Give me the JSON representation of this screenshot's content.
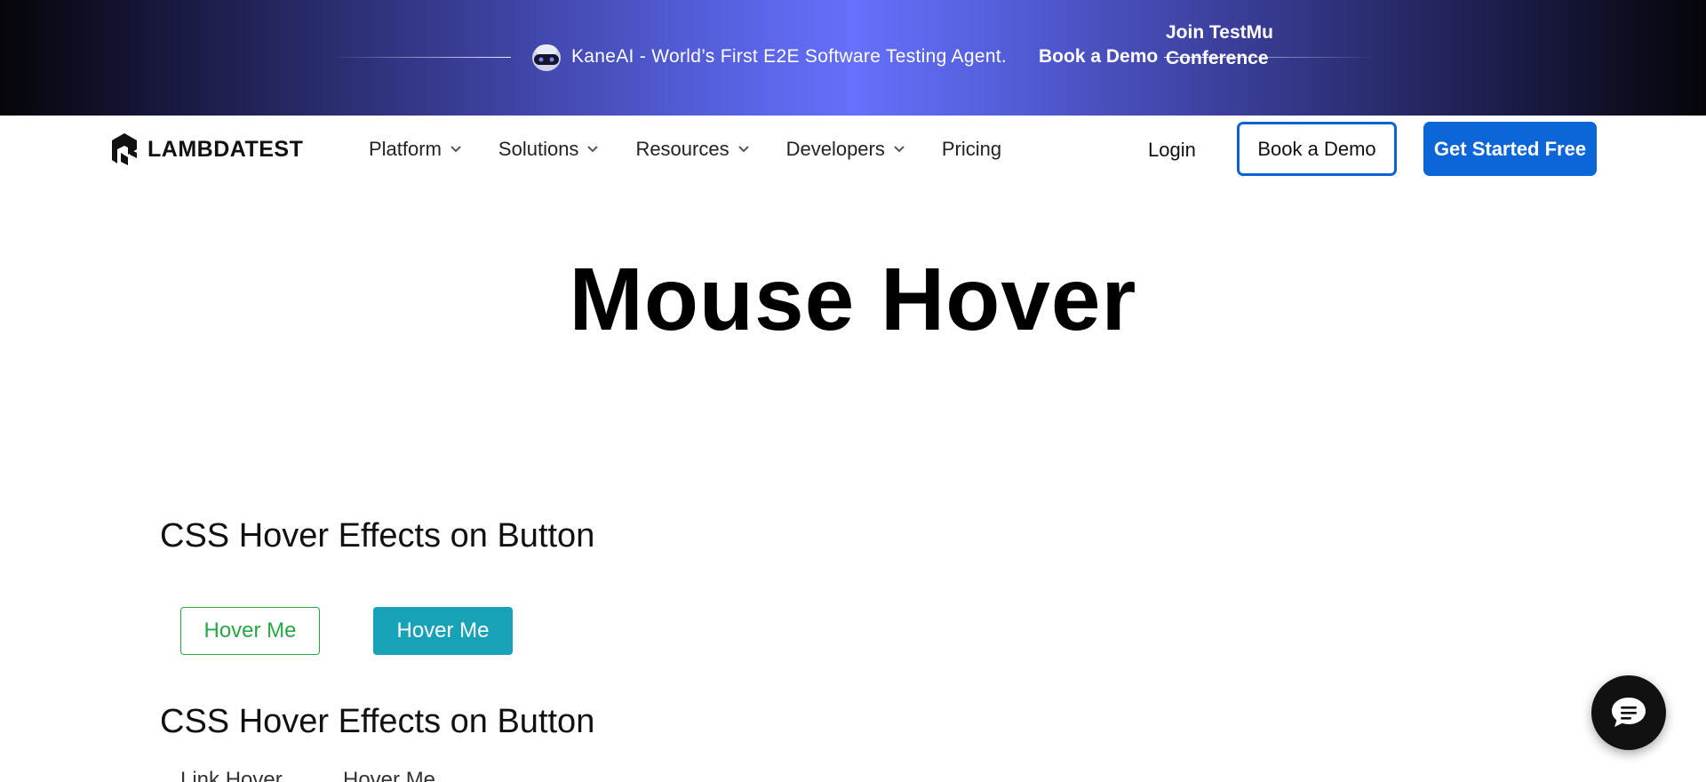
{
  "banner": {
    "promo_text": "KaneAI - World’s First E2E Software Testing Agent.",
    "demo_link": "Book a Demo",
    "conference_link": "Join TestMu Conference"
  },
  "header": {
    "logo_text": "LAMBDATEST",
    "nav": [
      {
        "label": "Platform",
        "has_dropdown": true
      },
      {
        "label": "Solutions",
        "has_dropdown": true
      },
      {
        "label": "Resources",
        "has_dropdown": true
      },
      {
        "label": "Developers",
        "has_dropdown": true
      },
      {
        "label": "Pricing",
        "has_dropdown": false
      }
    ],
    "login_label": "Login",
    "book_demo_label": "Book a Demo",
    "get_started_label": "Get Started Free"
  },
  "main": {
    "title": "Mouse Hover",
    "section1_title": "CSS Hover Effects on Button",
    "buttons": [
      "Hover Me",
      "Hover Me"
    ],
    "section2_title": "CSS Hover Effects on Button",
    "links": [
      "Link Hover",
      "Hover Me"
    ]
  },
  "colors": {
    "primary_blue": "#0c66d8",
    "success_green": "#28a745",
    "info_teal": "#17a2b8",
    "banner_accent": "#6570fb"
  },
  "icons": {
    "banner": "kaneai-robot-icon",
    "logo": "lambdatest-logo-icon",
    "nav_dropdown": "chevron-down-icon",
    "chat": "chat-bubble-icon"
  }
}
